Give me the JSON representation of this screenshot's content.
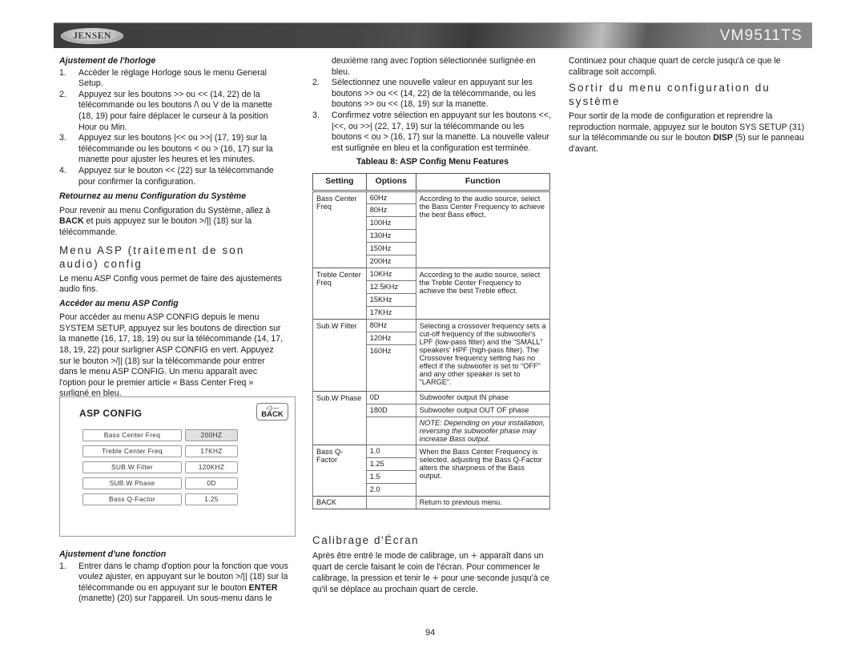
{
  "header": {
    "brand": "JENSEN",
    "model": "VM9511TS"
  },
  "col1": {
    "clock": {
      "title": "Ajustement de l'horloge",
      "steps": [
        {
          "num": "1.",
          "text": "Accéder le réglage Horloge sous le menu General Setup."
        },
        {
          "num": "2.",
          "text": "Appuyez sur les boutons >> ou << (14, 22) de la télécommande ou les boutons /\\ ou V de la manette (18, 19) pour faire déplacer le curseur à la position Hour ou Min."
        },
        {
          "num": "3.",
          "text": "Appuyez sur les boutons |<< ou >>| (17, 19) sur la télécommande ou les boutons < ou > (16, 17) sur la manette pour ajuster les heures et les minutes."
        },
        {
          "num": "4.",
          "text": "Appuyez sur le bouton << (22) sur la télécommande pour confirmer la configuration."
        }
      ]
    },
    "return": {
      "title": "Retournez au menu Configuration du Système",
      "text_pre": "Pour revenir au menu Configuration du Système, allez à ",
      "text_bold": "BACK",
      "text_post": " et puis appuyez sur le bouton >/|| (18) sur la télécommande."
    },
    "asp": {
      "heading": "Menu ASP (traitement de son audio) config",
      "intro": "Le menu ASP Config vous permet de faire des ajustements audio fins.",
      "access_title": "Accéder au menu ASP Config",
      "access_text": "Pour accéder au menu ASP CONFIG depuis le menu SYSTEM SETUP, appuyez sur les boutons de direction sur la manette (16, 17, 18, 19) ou sur la télécommande (14, 17, 18, 19, 22) pour surligner ASP CONFIG en vert. Appuyez sur le bouton >/|| (18) sur la télécommande pour entrer dans le menu ASP CONFIG. Un menu apparaît avec l'option pour le premier article « Bass Center Freq » surligné en bleu."
    },
    "function": {
      "title": "Ajustement d'une fonction",
      "step1_num": "1.",
      "step1_pre": "Entrer dans le champ d'option pour la fonction que vous voulez ajuster, en appuyant sur le bouton >/|| (18) sur la télécommande ou en appuyant sur le bouton ",
      "step1_bold": "ENTER",
      "step1_post": " (manette) (20) sur l'appareil. Un sous-menu dans le"
    }
  },
  "screen": {
    "title": "ASP CONFIG",
    "back_arrow": "◁—",
    "back_label": "BACK",
    "rows": [
      {
        "label": "Bass Center Freq",
        "value": "200HZ",
        "selected": true
      },
      {
        "label": "Treble Center Freq",
        "value": "17KHZ",
        "selected": false
      },
      {
        "label": "SUB.W Filter",
        "value": "120KHZ",
        "selected": false
      },
      {
        "label": "SUB.W Phase",
        "value": "0D",
        "selected": false
      },
      {
        "label": "Bass Q-Factor",
        "value": "1.25",
        "selected": false
      }
    ]
  },
  "col2": {
    "cont_text": "deuxième rang avec l'option sélectionnée surlignée en bleu.",
    "steps": [
      {
        "num": "2.",
        "text": "Sélectionnez une nouvelle valeur en appuyant sur les boutons >> ou << (14, 22) de la télécommande, ou les boutons >> ou << (18, 19) sur la manette."
      },
      {
        "num": "3.",
        "text": "Confirmez votre sélection en appuyant sur les boutons <<, |<<, ou >>| (22, 17, 19) sur la télécommande ou les boutons < ou > (16, 17) sur la manette. La nouvelle valeur est surlignée en bleu et la configuration est terminée."
      }
    ],
    "table": {
      "title": "Tableau 8: ASP Config Menu Features",
      "headers": [
        "Setting",
        "Options",
        "Function"
      ],
      "groups": [
        {
          "setting": "Bass Center Freq",
          "options": [
            "60Hz",
            "80Hz",
            "100Hz",
            "130Hz",
            "150Hz",
            "200Hz"
          ],
          "function": "According to the audio source, select the Bass Center Frequency to achieve the best Bass effect."
        },
        {
          "setting": "Treble Center Freq",
          "options": [
            "10KHz",
            "12.5KHz",
            "15KHz",
            "17KHz"
          ],
          "function": "According to the audio source, select the Treble Center Frequency to achieve the best Treble effect."
        },
        {
          "setting": "Sub.W Filter",
          "options": [
            "80Hz",
            "120Hz",
            "160Hz"
          ],
          "function": "Selecting a crossover frequency sets a cut-off frequency of the subwoofer's LPF (low-pass filter) and the “SMALL” speakers' HPF (high-pass filter). The Crossover frequency setting has no effect if the subwoofer is set to “OFF” and any other speaker is set to “LARGE”."
        },
        {
          "setting": "Sub.W Phase",
          "rows": [
            {
              "option": "0D",
              "function": "Subwoofer output IN phase"
            },
            {
              "option": "180D",
              "function": "Subwoofer output OUT OF phase"
            },
            {
              "option": "",
              "function": "NOTE: Depending on your installation, reversing the subwoofer phase may increase Bass output."
            }
          ]
        },
        {
          "setting": "Bass Q-Factor",
          "options": [
            "1.0",
            "1.25",
            "1.5",
            "2.0"
          ],
          "function": "When the Bass Center Frequency is selected, adjusting the Bass Q-Factor alters the sharpness of the Bass output."
        },
        {
          "setting": "BACK",
          "options": [
            ""
          ],
          "function": "Return to previous menu."
        }
      ]
    },
    "calib": {
      "heading": "Calibrage d'Écran",
      "t1": "Après être entré le mode de calibrage, un ",
      "plus_icon": "+",
      "t2": " apparaît dans un quart de cercle faisant le coin de l'écran. Pour commencer le calibrage, la pression et tenir le ",
      "t3": " pour une seconde jusqu'à ce qu'il se déplace au prochain quart de cercle."
    }
  },
  "col3": {
    "cont_text": "Continuez pour chaque quart de cercle jusqu'à ce que le calibrage soit accompli.",
    "exit_heading": "Sortir du menu configuration du système",
    "exit_pre": "Pour sortir de la mode de configuration et reprendre la reproduction normale, appuyez sur le bouton SYS SETUP (31) sur la télécommande ou sur le bouton ",
    "exit_bold": "DISP",
    "exit_post": " (5) sur le panneau d'avant."
  },
  "page_number": "94"
}
